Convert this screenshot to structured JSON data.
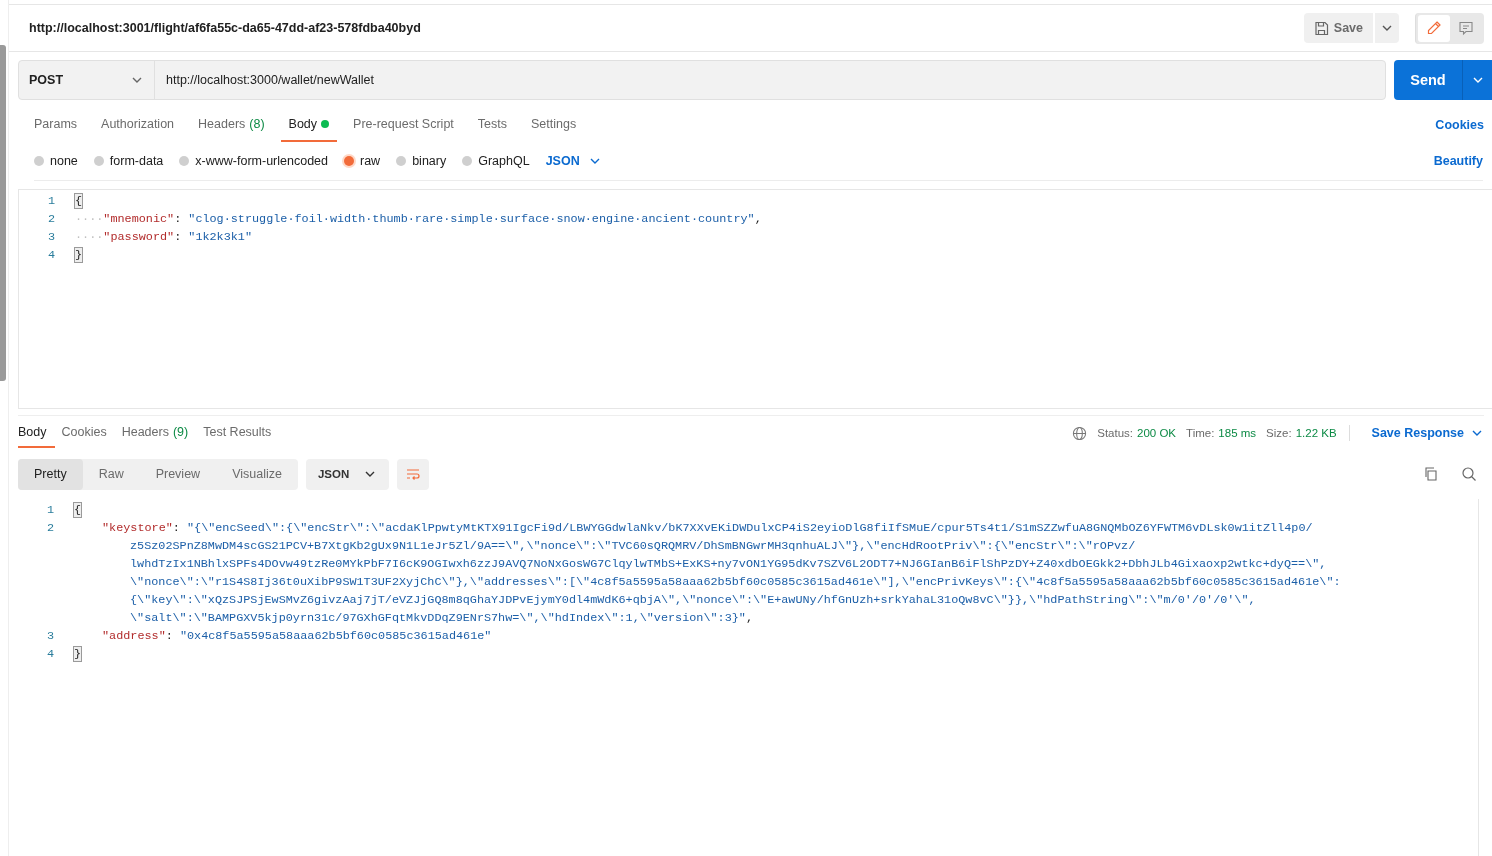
{
  "request_title": "http://localhost:3001/flight/af6fa55c-da65-47dd-af23-578fdba40byd",
  "save_button": "Save",
  "method": "POST",
  "url": "http://localhost:3000/wallet/newWallet",
  "send_button": "Send",
  "request_tabs": [
    {
      "label": "Params",
      "selected": false
    },
    {
      "label": "Authorization",
      "selected": false
    },
    {
      "label": "Headers",
      "count": "(8)",
      "selected": false
    },
    {
      "label": "Body",
      "selected": true,
      "indicator": true
    },
    {
      "label": "Pre-request Script",
      "selected": false
    },
    {
      "label": "Tests",
      "selected": false
    },
    {
      "label": "Settings",
      "selected": false
    }
  ],
  "cookies_link": "Cookies",
  "body_types": [
    {
      "label": "none",
      "selected": false
    },
    {
      "label": "form-data",
      "selected": false
    },
    {
      "label": "x-www-form-urlencoded",
      "selected": false
    },
    {
      "label": "raw",
      "selected": true
    },
    {
      "label": "binary",
      "selected": false
    },
    {
      "label": "GraphQL",
      "selected": false
    }
  ],
  "body_format": "JSON",
  "beautify_link": "Beautify",
  "request_body": [
    {
      "number": "1",
      "tokens": [
        {
          "kind": "brace-match",
          "text": "{"
        }
      ]
    },
    {
      "number": "2",
      "tokens": [
        {
          "kind": "space",
          "text": "····"
        },
        {
          "kind": "key",
          "text": "\"mnemonic\""
        },
        {
          "kind": "punct",
          "text": ": "
        },
        {
          "kind": "string",
          "text": "\"clog·struggle·foil·width·thumb·rare·simple·surface·snow·engine·ancient·country\""
        },
        {
          "kind": "punct",
          "text": ","
        }
      ]
    },
    {
      "number": "3",
      "tokens": [
        {
          "kind": "space",
          "text": "····"
        },
        {
          "kind": "key",
          "text": "\"password\""
        },
        {
          "kind": "punct",
          "text": ": "
        },
        {
          "kind": "string",
          "text": "\"1k2k3k1\""
        }
      ]
    },
    {
      "number": "4",
      "tokens": [
        {
          "kind": "brace-match",
          "text": "}"
        }
      ]
    }
  ],
  "response_tabs": [
    {
      "label": "Body",
      "selected": true
    },
    {
      "label": "Cookies",
      "selected": false
    },
    {
      "label": "Headers",
      "count": "(9)",
      "selected": false
    },
    {
      "label": "Test Results",
      "selected": false
    }
  ],
  "status": [
    {
      "label": "Status:",
      "value": "200 OK"
    },
    {
      "label": "Time:",
      "value": "185 ms"
    },
    {
      "label": "Size:",
      "value": "1.22 KB"
    }
  ],
  "save_response": "Save Response",
  "view_modes": [
    {
      "label": "Pretty",
      "selected": true
    },
    {
      "label": "Raw",
      "selected": false
    },
    {
      "label": "Preview",
      "selected": false
    },
    {
      "label": "Visualize",
      "selected": false
    }
  ],
  "response_format": "JSON",
  "response_body": [
    {
      "number": "1",
      "tokens": [
        {
          "kind": "brace-match",
          "text": "{"
        }
      ]
    },
    {
      "number": "2",
      "kind": "member",
      "tokens": [
        {
          "kind": "key",
          "text": "\"keystore\""
        },
        {
          "kind": "punct",
          "text": ": "
        },
        {
          "kind": "string",
          "text": "\"{\\\"encSeed\\\":{\\\"encStr\\\":\\\"acdaKlPpwtyMtKTX91IgcFi9d/LBWYGGdwlaNkv/bK7XXvEKiDWDulxCP4iS2eyioDlG8fiIfSMuE/cpur5Ts4t1/S1mSZZwfuA8GNQMbOZ6YFWTM6vDLsk0w1itZll4p0/"
        }
      ]
    },
    {
      "kind": "wrap",
      "tokens": [
        {
          "kind": "string",
          "text": "z5Sz02SPnZ8MwDM4scGS21PCV+B7XtgKb2gUx9N1L1eJr5Zl/9A==\\\",\\\"nonce\\\":\\\"TVC60sQRQMRV/DhSmBNGwrMH3qnhuALJ\\\"},\\\"encHdRootPriv\\\":{\\\"encStr\\\":\\\"rOPvz/"
        }
      ]
    },
    {
      "kind": "wrap",
      "tokens": [
        {
          "kind": "string",
          "text": "lwhdTzIx1NBhlxSPFs4DOvw49tzRe0MYkPbF7I6cK9OGIwxh6zzJ9AVQ7NoNxGosWG7ClqylwTMbS+ExKS+ny7vON1YG95dKv7SZV6L2ODT7+NJ6GIanB6iFlShPzDY+Z40xdbOEGkk2+DbhJLb4Gixaoxp2wtkc+dyQ==\\\","
        }
      ]
    },
    {
      "kind": "wrap",
      "tokens": [
        {
          "kind": "string",
          "text": "\\\"nonce\\\":\\\"r1S4S8Ij36t0uXibP9SW1T3UF2XyjChC\\\"},\\\"addresses\\\":[\\\"4c8f5a5595a58aaa62b5bf60c0585c3615ad461e\\\"],\\\"encPrivKeys\\\":{\\\"4c8f5a5595a58aaa62b5bf60c0585c3615ad461e\\\":"
        }
      ]
    },
    {
      "kind": "wrap",
      "tokens": [
        {
          "kind": "string",
          "text": "{\\\"key\\\":\\\"xQzSJPSjEwSMvZ6givzAaj7jT/eVZJjGQ8m8qGhaYJDPvEjymY0dl4mWdK6+qbjA\\\",\\\"nonce\\\":\\\"E+awUNy/hfGnUzh+srkYahaL31oQw8vC\\\"}},\\\"hdPathString\\\":\\\"m/0'/0'/0'\\\","
        }
      ]
    },
    {
      "kind": "wrap",
      "tokens": [
        {
          "kind": "string",
          "text": "\\\"salt\\\":\\\"BAMPGXV5kjp0yrn31c/97GXhGFqtMkvDDqZ9ENrS7hw=\\\",\\\"hdIndex\\\":1,\\\"version\\\":3}\""
        },
        {
          "kind": "punct",
          "text": ","
        }
      ]
    },
    {
      "number": "3",
      "kind": "member",
      "tokens": [
        {
          "kind": "key",
          "text": "\"address\""
        },
        {
          "kind": "punct",
          "text": ": "
        },
        {
          "kind": "string",
          "text": "\"0x4c8f5a5595a58aaa62b5bf60c0585c3615ad461e\""
        }
      ]
    },
    {
      "number": "4",
      "tokens": [
        {
          "kind": "brace-match",
          "text": "}"
        }
      ]
    }
  ]
}
